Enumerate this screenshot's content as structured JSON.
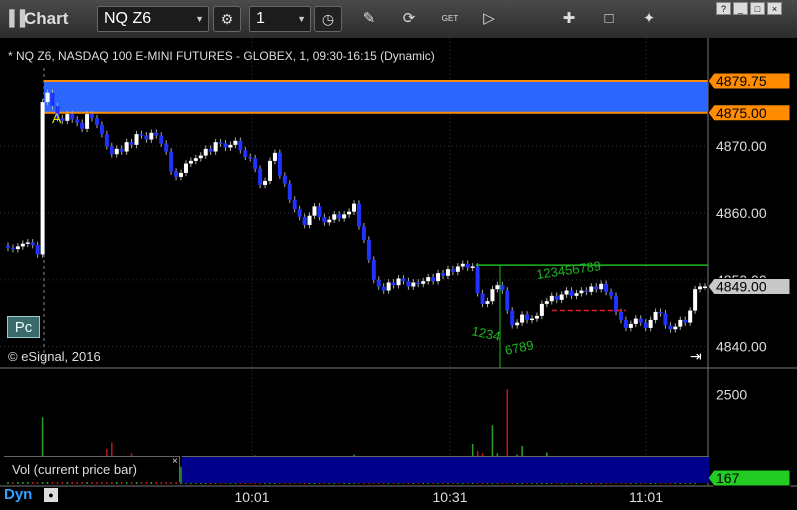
{
  "toolbar": {
    "title": "Chart",
    "symbol": "NQ Z6",
    "interval": "1",
    "icons": [
      "settings-icon",
      "clock-icon",
      "pencil-icon",
      "refresh-icon",
      "get-icon",
      "play-icon",
      "pin-icon",
      "comment-icon",
      "twitter-icon"
    ]
  },
  "window_buttons": [
    "?",
    "_",
    "□",
    "×"
  ],
  "chart_header": "* NQ Z6, NASDAQ 100 E-MINI FUTURES - GLOBEX, 1, 09:30-16:15 (Dynamic)",
  "copyright": "© eSignal, 2016",
  "pc_button": "Pc",
  "vol_label": "Vol (current price bar)",
  "vol_close": "×",
  "dyn_label": "Dyn",
  "colors": {
    "up": "#ffffff",
    "down": "#1f32ff",
    "band": "#2b66ff",
    "band_border": "#ff8c00",
    "green": "#1fb81f",
    "vol_up": "#2aa02a",
    "vol_down": "#c01818",
    "last_price_tag": "#c8c8c8",
    "vol_tag": "#22cc22"
  },
  "chart_data": {
    "type": "candlestick",
    "price_axis": {
      "ticks": [
        "4840.00",
        "4850.00",
        "4860.00",
        "4870.00"
      ],
      "range": [
        4838,
        4882
      ]
    },
    "price_tags": {
      "band_high": "4879.75",
      "band_low": "4875.00",
      "last": "4849.00"
    },
    "band": [
      4875.0,
      4879.75
    ],
    "time_axis": {
      "ticks": [
        "10:01",
        "10:31",
        "11:01"
      ]
    },
    "volume_axis": {
      "ticks": [
        "2500"
      ],
      "last": "167"
    },
    "annotations": {
      "marker_a": "A",
      "seq_1": "1234",
      "seq_2": "6789",
      "seq_3": "123456789",
      "seq_4": "6789"
    },
    "level_lines": [
      {
        "price": 4852.2,
        "color": "green"
      },
      {
        "price": 4845.4,
        "color": "red"
      }
    ],
    "closes": [
      4854.8,
      4854.6,
      4855.0,
      4855.4,
      4855.6,
      4855.2,
      4853.8,
      4876.6,
      4878.0,
      4876.0,
      4874.2,
      4873.8,
      4874.8,
      4874.0,
      4873.5,
      4872.6,
      4874.8,
      4874.2,
      4873.2,
      4871.8,
      4870.0,
      4868.8,
      4869.6,
      4869.2,
      4870.6,
      4870.2,
      4871.8,
      4871.6,
      4871.0,
      4872.0,
      4871.6,
      4870.4,
      4869.2,
      4866.2,
      4865.4,
      4866.0,
      4867.4,
      4867.8,
      4868.2,
      4868.6,
      4869.6,
      4869.2,
      4870.6,
      4870.4,
      4869.8,
      4870.2,
      4870.8,
      4869.4,
      4868.4,
      4868.2,
      4866.6,
      4864.2,
      4864.8,
      4867.8,
      4869.0,
      4865.6,
      4864.4,
      4862.0,
      4860.6,
      4859.4,
      4858.2,
      4859.6,
      4861.0,
      4859.4,
      4858.6,
      4859.0,
      4859.8,
      4859.2,
      4859.8,
      4860.2,
      4861.4,
      4858.0,
      4856.0,
      4853.0,
      4850.0,
      4849.0,
      4848.4,
      4849.6,
      4849.2,
      4850.2,
      4849.8,
      4849.0,
      4849.6,
      4849.4,
      4849.8,
      4850.4,
      4849.8,
      4851.0,
      4850.6,
      4851.6,
      4851.2,
      4852.0,
      4852.4,
      4851.8,
      4852.0,
      4848.0,
      4846.4,
      4846.8,
      4848.6,
      4849.2,
      4848.4,
      4845.4,
      4843.2,
      4843.6,
      4844.8,
      4844.0,
      4844.2,
      4844.6,
      4846.4,
      4846.8,
      4847.6,
      4847.0,
      4847.8,
      4848.4,
      4847.6,
      4848.0,
      4848.4,
      4848.2,
      4849.0,
      4848.6,
      4849.4,
      4848.2,
      4847.6,
      4845.2,
      4844.0,
      4842.8,
      4843.4,
      4844.2,
      4843.6,
      4842.8,
      4844.0,
      4845.2,
      4845.0,
      4843.2,
      4842.6,
      4843.0,
      4844.0,
      4843.6,
      4845.4,
      4848.6,
      4849.0,
      4849.0
    ],
    "volumes": [
      310,
      280,
      290,
      300,
      330,
      360,
      520,
      1860,
      780,
      520,
      440,
      400,
      380,
      360,
      620,
      340,
      300,
      320,
      440,
      420,
      980,
      1150,
      650,
      520,
      700,
      860,
      420,
      380,
      460,
      400,
      460,
      540,
      760,
      700,
      420,
      480,
      620,
      380,
      360,
      560,
      380,
      320,
      300,
      480,
      360,
      320,
      420,
      340,
      420,
      720,
      800,
      560,
      300,
      400,
      560,
      320,
      440,
      540,
      620,
      700,
      380,
      360,
      480,
      420,
      420,
      360,
      460,
      420,
      560,
      520,
      820,
      760,
      600,
      540,
      640,
      560,
      620,
      480,
      560,
      720,
      620,
      540,
      520,
      580,
      460,
      640,
      440,
      420,
      480,
      540,
      380,
      560,
      460,
      560,
      1120,
      920,
      860,
      760,
      1640,
      860,
      600,
      2640,
      660,
      820,
      1060,
      780,
      680,
      600,
      760,
      880,
      660,
      720,
      540,
      620,
      480,
      620,
      500,
      420,
      600,
      420,
      560,
      480,
      440,
      460,
      380,
      600,
      560,
      520,
      460,
      480,
      380,
      440,
      360,
      580,
      560,
      640,
      720,
      520,
      600,
      440
    ]
  }
}
